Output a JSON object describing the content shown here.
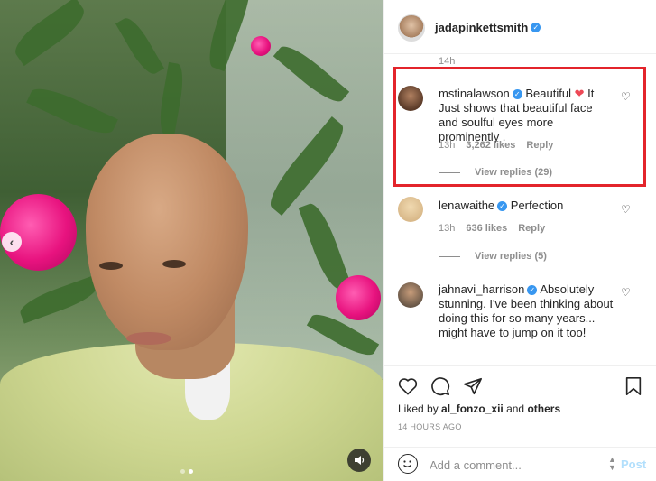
{
  "post": {
    "author": "jadapinkettsmith",
    "author_verified": true,
    "caption_time": "14h"
  },
  "comments": [
    {
      "username": "mstinalawson",
      "verified": true,
      "text_before": "Beautiful",
      "text_after": "It Just shows that beautiful face and soulful eyes more prominently .",
      "emoji": "red-heart",
      "time": "13h",
      "likes": "3,262 likes",
      "reply": "Reply",
      "view_replies": "View replies (29)",
      "highlighted": true
    },
    {
      "username": "lenawaithe",
      "verified": true,
      "text": "Perfection",
      "time": "13h",
      "likes": "636 likes",
      "reply": "Reply",
      "view_replies": "View replies (5)"
    },
    {
      "username": "jahnavi_harrison",
      "verified": true,
      "text": "Absolutely stunning. I've been thinking about doing this for so many years... might have to jump on it too!"
    }
  ],
  "liked_by": {
    "prefix": "Liked by",
    "user": "al_fonzo_xii",
    "conjunction": "and",
    "others": "others"
  },
  "timestamp": "14 HOURS AGO",
  "add_comment": {
    "placeholder": "Add a comment...",
    "post_label": "Post"
  },
  "colors": {
    "verified": "#3897f0",
    "highlight_border": "#e3242b",
    "post_disabled": "#b2dffc"
  },
  "icons": {
    "like": "heart-outline-icon",
    "comment": "comment-bubble-icon",
    "share": "paper-plane-icon",
    "save": "bookmark-icon",
    "emoji": "smiley-icon",
    "audio": "speaker-icon",
    "prev": "chevron-left-icon"
  }
}
